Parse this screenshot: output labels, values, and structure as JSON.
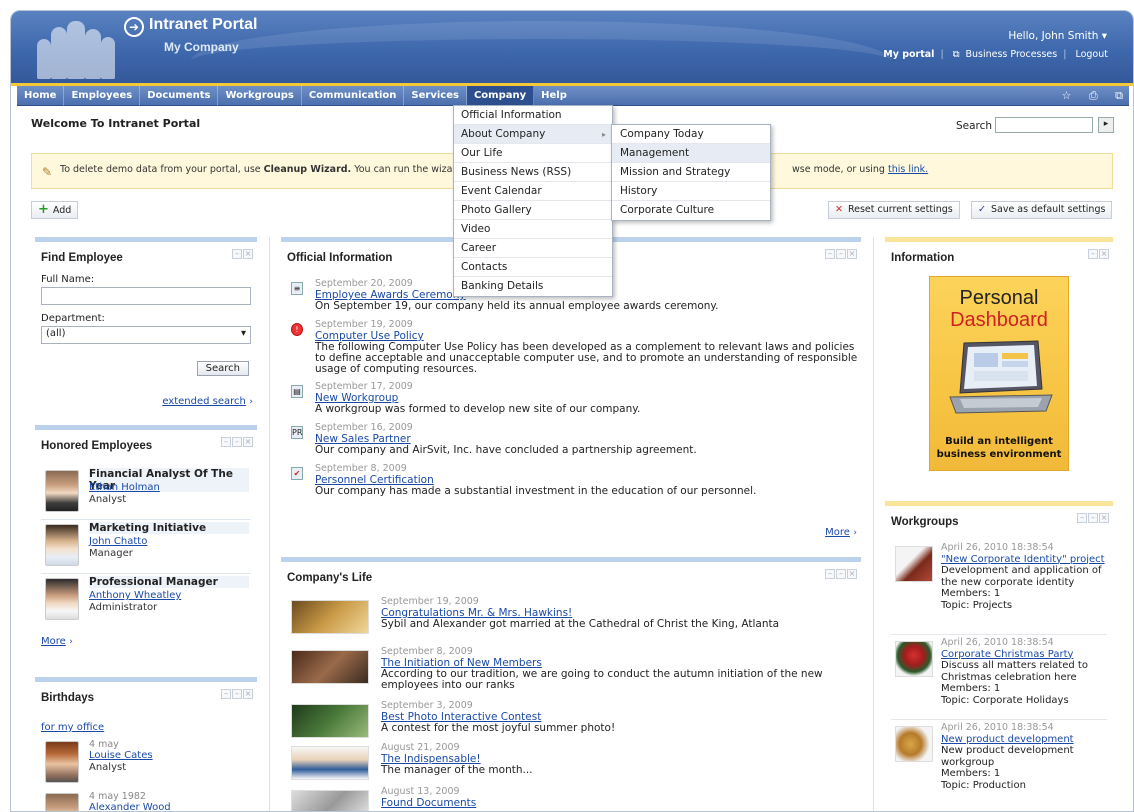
{
  "header": {
    "portal_title": "Intranet Portal",
    "company_name": "My Company",
    "greeting": "Hello, John Smith",
    "links": [
      "My portal",
      "Business Processes",
      "Logout"
    ]
  },
  "nav": {
    "items": [
      "Home",
      "Employees",
      "Documents",
      "Workgroups",
      "Communication",
      "Services",
      "Company",
      "Help"
    ],
    "active": "Company"
  },
  "company_menu": {
    "items": [
      "Official Information",
      "About Company",
      "Our Life",
      "Business News (RSS)",
      "Event Calendar",
      "Photo Gallery",
      "Video",
      "Career",
      "Contacts",
      "Banking Details"
    ],
    "submenu": [
      "Company Today",
      "Management",
      "Mission and Strategy",
      "History",
      "Corporate Culture"
    ]
  },
  "page": {
    "title": "Welcome To Intranet Portal",
    "search_label": "Search",
    "info_text_a": "To delete demo data from your portal, use ",
    "info_wizard": "Cleanup Wizard.",
    "info_text_b": " You can run the wizard",
    "info_text_c": "wse mode, or using ",
    "info_link": "this link.",
    "add_label": "Add",
    "reset_label": "Reset current settings",
    "save_label": "Save as default settings"
  },
  "find_employee": {
    "title": "Find Employee",
    "full_name_label": "Full Name:",
    "department_label": "Department:",
    "department_value": "(all)",
    "search_button": "Search",
    "extended_search": "extended search"
  },
  "honored": {
    "title": "Honored Employees",
    "people": [
      {
        "title": "Financial Analyst Of The Year",
        "name": "Ethan Holman",
        "role": "Analyst"
      },
      {
        "title": "Marketing Initiative",
        "name": "John Chatto",
        "role": "Manager"
      },
      {
        "title": "Professional Manager",
        "name": "Anthony Wheatley",
        "role": "Administrator"
      }
    ],
    "more": "More"
  },
  "birthdays": {
    "title": "Birthdays",
    "for_my_office": "for my office",
    "people": [
      {
        "date": "4 may",
        "name": "Louise Cates",
        "role": "Analyst"
      },
      {
        "date": "4 may 1982",
        "name": "Alexander Wood",
        "role": ""
      }
    ]
  },
  "official_info": {
    "title": "Official Information",
    "items": [
      {
        "date": "September 20, 2009",
        "title": "Employee Awards Ceremony",
        "text": "On September 19, our company held its annual employee awards ceremony."
      },
      {
        "date": "September 19, 2009",
        "title": "Computer Use Policy",
        "text": "The following Computer Use Policy has been developed as a complement to relevant laws and policies to define acceptable and unacceptable computer use, and to promote an understanding of responsible usage of computing resources."
      },
      {
        "date": "September 17, 2009",
        "title": "New Workgroup",
        "text": "A workgroup was formed to develop new site of our company."
      },
      {
        "date": "September 16, 2009",
        "title": "New Sales Partner",
        "text": "Our company and AirSvit, Inc. have concluded a partnership agreement."
      },
      {
        "date": "September 8, 2009",
        "title": "Personnel Certification",
        "text": "Our company has made a substantial investment in the education of our personnel."
      }
    ],
    "more": "More"
  },
  "company_life": {
    "title": "Company's Life",
    "items": [
      {
        "date": "September 19, 2009",
        "title": "Congratulations Mr. & Mrs. Hawkins!",
        "text": "Sybil and Alexander got married at the Cathedral of Christ the King, Atlanta"
      },
      {
        "date": "September 8, 2009",
        "title": "The Initiation of New Members",
        "text": "According to our tradition, we are going to conduct the autumn initiation of the new employees into our ranks"
      },
      {
        "date": "September 3, 2009",
        "title": "Best Photo Interactive Contest",
        "text": "A contest for the most joyful summer photo!"
      },
      {
        "date": "August 21, 2009",
        "title": "The Indispensable!",
        "text": "The manager of the month..."
      },
      {
        "date": "August 13, 2009",
        "title": "Found Documents",
        "text": ""
      }
    ]
  },
  "information": {
    "title": "Information",
    "ad_line1": "Personal",
    "ad_line2": "Dashboard",
    "ad_caption": "Build an intelligent business environment"
  },
  "workgroups": {
    "title": "Workgroups",
    "items": [
      {
        "date": "April 26, 2010 18:38:54",
        "title": "\"New Corporate Identity\" project",
        "desc": "Development and application of the new corporate identity",
        "members": "Members: 1",
        "topic": "Topic: Projects"
      },
      {
        "date": "April 26, 2010 18:38:54",
        "title": "Corporate Christmas Party",
        "desc": "Discuss all matters related to Christmas celebration here",
        "members": "Members: 1",
        "topic": "Topic: Corporate Holidays"
      },
      {
        "date": "April 26, 2010 18:38:54",
        "title": "New product development",
        "desc": "New product development workgroup",
        "members": "Members: 1",
        "topic": "Topic: Production"
      }
    ]
  },
  "colors": {
    "header_blue": "#3e68ad",
    "nav_blue": "#4b6fae",
    "accent_yellow": "#f5c83a",
    "link_blue": "#1a4aa8"
  }
}
